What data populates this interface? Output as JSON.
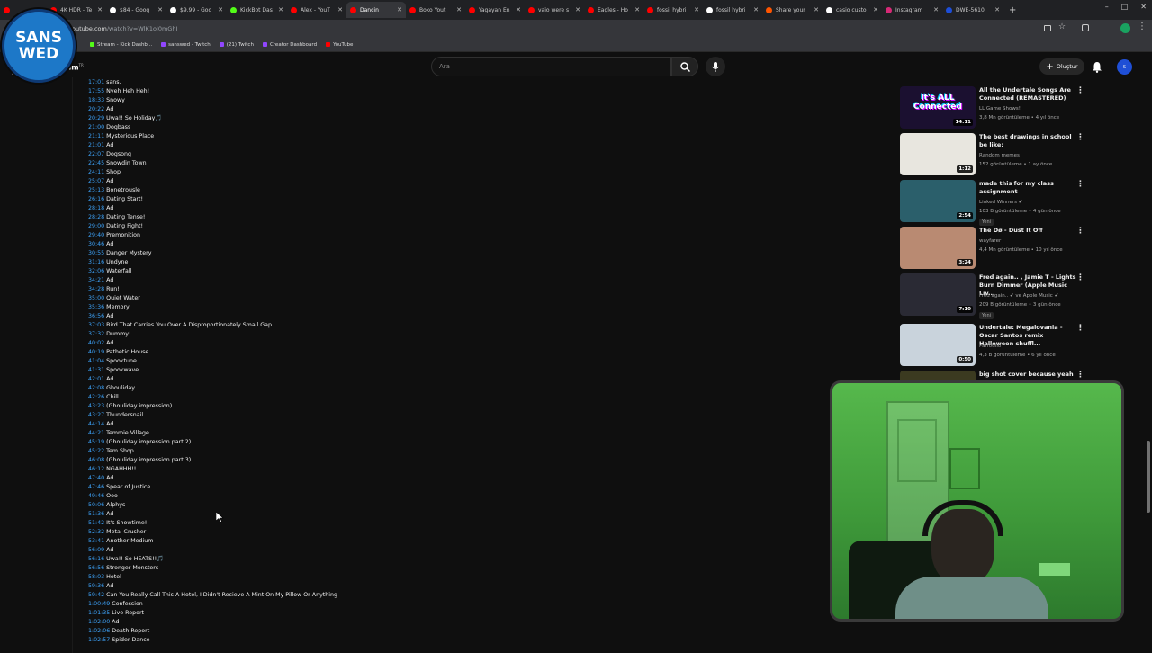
{
  "browser": {
    "tabs": [
      {
        "label": "",
        "color": "#ff0000"
      },
      {
        "label": "4K HDR - Te",
        "color": "#ff0000"
      },
      {
        "label": "$84 - Goog",
        "color": "#ffffff"
      },
      {
        "label": "$9.99 - Goo",
        "color": "#ffffff"
      },
      {
        "label": "KickBot Das",
        "color": "#53fc18"
      },
      {
        "label": "Alex - YouT",
        "color": "#ff0000"
      },
      {
        "label": "Dancin",
        "color": "#ff0000",
        "active": true
      },
      {
        "label": "Boko Yout",
        "color": "#ff0000"
      },
      {
        "label": "Yagayan En",
        "color": "#ff0000"
      },
      {
        "label": "vaio were s",
        "color": "#ff0000"
      },
      {
        "label": "Eagles - Ho",
        "color": "#ff0000"
      },
      {
        "label": "fossil hybri",
        "color": "#ff0000"
      },
      {
        "label": "fossil hybri",
        "color": "#ffffff"
      },
      {
        "label": "Share your",
        "color": "#ff5500"
      },
      {
        "label": "casio custo",
        "color": "#ffffff"
      },
      {
        "label": "Instagram",
        "color": "#d62976"
      },
      {
        "label": "DWE-5610",
        "color": "#1d4ed8"
      }
    ],
    "new_tab": "+",
    "url_host": "outube.com",
    "url_path": "/watch?v=WlK1oI0mGhI",
    "bookmarks": [
      {
        "label": "Stream - Kick Dashb...",
        "color": "#53fc18"
      },
      {
        "label": "sanswed - Twitch",
        "color": "#9146ff"
      },
      {
        "label": "(21) Twitch",
        "color": "#9146ff"
      },
      {
        "label": "Creator Dashboard",
        "color": "#9146ff"
      },
      {
        "label": "YouTube",
        "color": "#ff0000"
      }
    ]
  },
  "youtube": {
    "premium_label": "emium",
    "premium_sup": "TR",
    "search_placeholder": "Ara",
    "create_label": "Oluştur",
    "account_initial": "S"
  },
  "overlay_logo": {
    "line1": "SANS",
    "line2": "WED"
  },
  "chapters": [
    {
      "time": "17:01",
      "title": "sans."
    },
    {
      "time": "17:55",
      "title": "Nyeh Heh Heh!"
    },
    {
      "time": "18:33",
      "title": "Snowy"
    },
    {
      "time": "20:22",
      "title": "Ad"
    },
    {
      "time": "20:29",
      "title": "Uwa!! So Holiday🎵"
    },
    {
      "time": "21:00",
      "title": "Dogbass"
    },
    {
      "time": "21:11",
      "title": "Mysterious Place"
    },
    {
      "time": "21:01",
      "title": "Ad"
    },
    {
      "time": "22:07",
      "title": "Dogsong"
    },
    {
      "time": "22:45",
      "title": "Snowdin Town"
    },
    {
      "time": "24:11",
      "title": "Shop"
    },
    {
      "time": "25:07",
      "title": "Ad"
    },
    {
      "time": "25:13",
      "title": "Bonetrousle"
    },
    {
      "time": "26:16",
      "title": "Dating Start!"
    },
    {
      "time": "28:18",
      "title": "Ad"
    },
    {
      "time": "28:28",
      "title": "Dating Tense!"
    },
    {
      "time": "29:00",
      "title": "Dating Fight!"
    },
    {
      "time": "29:40",
      "title": "Premonition"
    },
    {
      "time": "30:46",
      "title": "Ad"
    },
    {
      "time": "30:55",
      "title": "Danger Mystery"
    },
    {
      "time": "31:16",
      "title": "Undyne"
    },
    {
      "time": "32:06",
      "title": "Waterfall"
    },
    {
      "time": "34:21",
      "title": "Ad"
    },
    {
      "time": "34:28",
      "title": "Run!"
    },
    {
      "time": "35:00",
      "title": "Quiet Water"
    },
    {
      "time": "35:36",
      "title": "Memory"
    },
    {
      "time": "36:56",
      "title": "Ad"
    },
    {
      "time": "37:03",
      "title": "Bird That Carries You Over A Disproportionately Small Gap"
    },
    {
      "time": "37:32",
      "title": "Dummy!"
    },
    {
      "time": "40:02",
      "title": "Ad"
    },
    {
      "time": "40:19",
      "title": "Pathetic House"
    },
    {
      "time": "41:04",
      "title": "Spooktune"
    },
    {
      "time": "41:31",
      "title": "Spookwave"
    },
    {
      "time": "42:01",
      "title": "Ad"
    },
    {
      "time": "42:08",
      "title": "Ghouliday"
    },
    {
      "time": "42:26",
      "title": "Chill"
    },
    {
      "time": "43:23",
      "title": "(Ghouliday impression)"
    },
    {
      "time": "43:27",
      "title": "Thundersnail"
    },
    {
      "time": "44:14",
      "title": "Ad"
    },
    {
      "time": "44:21",
      "title": "Temmie Village"
    },
    {
      "time": "45:19",
      "title": "(Ghouliday impression part 2)"
    },
    {
      "time": "45:22",
      "title": "Tem Shop"
    },
    {
      "time": "46:08",
      "title": "(Ghouliday impression part 3)"
    },
    {
      "time": "46:12",
      "title": "NGAHHH!!"
    },
    {
      "time": "47:40",
      "title": "Ad"
    },
    {
      "time": "47:46",
      "title": "Spear of Justice"
    },
    {
      "time": "49:46",
      "title": "Ooo"
    },
    {
      "time": "50:06",
      "title": "Alphys"
    },
    {
      "time": "51:36",
      "title": "Ad"
    },
    {
      "time": "51:42",
      "title": "It's Showtime!"
    },
    {
      "time": "52:32",
      "title": "Metal Crusher"
    },
    {
      "time": "53:41",
      "title": "Another Medium"
    },
    {
      "time": "56:09",
      "title": "Ad"
    },
    {
      "time": "56:16",
      "title": "Uwa!! So HEATS!!🎵"
    },
    {
      "time": "56:56",
      "title": "Stronger Monsters"
    },
    {
      "time": "58:03",
      "title": "Hotel"
    },
    {
      "time": "59:36",
      "title": "Ad"
    },
    {
      "time": "59:42",
      "title": "Can You Really Call This A Hotel, I Didn't Recieve A Mint On My Pillow Or Anything"
    },
    {
      "time": "1:00:49",
      "title": "Confession"
    },
    {
      "time": "1:01:35",
      "title": "Live Report"
    },
    {
      "time": "1:02:00",
      "title": "Ad"
    },
    {
      "time": "1:02:06",
      "title": "Death Report"
    },
    {
      "time": "1:02:57",
      "title": "Spider Dance"
    }
  ],
  "recommendations": [
    {
      "title": "All the Undertale Songs Are Connected (REMASTERED)",
      "channel": "LL Game Shows!",
      "meta": "3,8 Mn görüntüleme • 4 yıl önce",
      "duration": "14:11",
      "thumb": "#1b1030",
      "thumb_text": "It's ALL Connected"
    },
    {
      "title": "The best drawings in school be like:",
      "channel": "Random memes",
      "meta": "152 görüntüleme • 1 ay önce",
      "duration": "1:12",
      "thumb": "#e8e6df"
    },
    {
      "title": "made this for my class assignment",
      "channel": "Linked Winners ✔",
      "meta": "103 B görüntüleme • 4 gün önce",
      "badge": "Yeni",
      "duration": "2:54",
      "thumb": "#2b5f6b"
    },
    {
      "title": "The Dø - Dust It Off",
      "channel": "wayfarer",
      "meta": "4,4 Mn görüntüleme • 10 yıl önce",
      "duration": "3:24",
      "thumb": "#b98a72"
    },
    {
      "title": "Fred again.. , Jamie T - Lights Burn Dimmer (Apple Music Liv...",
      "channel": "Fred again.. ✔ ve Apple Music ✔",
      "meta": "209 B görüntüleme • 3 gün önce",
      "badge": "Yeni",
      "duration": "7:10",
      "thumb": "#2a2a34"
    },
    {
      "title": "Undertale: Megalovania - Oscar Santos remix Halloween shuffl...",
      "channel": "Parrotillo",
      "meta": "4,3 B görüntüleme • 6 yıl önce",
      "duration": "0:50",
      "thumb": "#c9d3dc"
    },
    {
      "title": "big shot cover because yeah",
      "channel": "",
      "meta": "",
      "duration": "",
      "thumb": "#3b3a20"
    }
  ]
}
